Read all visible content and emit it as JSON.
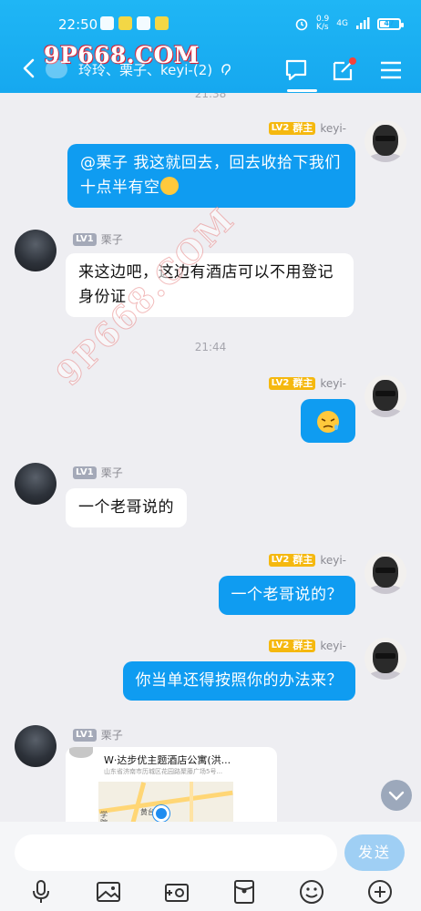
{
  "status_bar": {
    "time": "22:50",
    "network_speed": "0.9\nK/s",
    "network_type": "4G",
    "battery": "47",
    "battery_level": 0.47
  },
  "watermark": {
    "top": "9P668.COM",
    "diagonal": "9P668.COM"
  },
  "header": {
    "title": "玲玲、栗子、keyi-(2)",
    "icons": [
      "back-arrow-icon",
      "chat-bubble-icon",
      "edit-icon",
      "menu-icon"
    ],
    "accent_color": "#16a8ef",
    "notification_dot_color": "#f5433a"
  },
  "messages": [
    {
      "type": "time",
      "text": "21:38"
    },
    {
      "type": "msg",
      "side": "right",
      "sender": "keyi-",
      "level": "LV2",
      "role": "群主",
      "text": "@栗子  我这就回去，回去收拾下我们十点半有空"
    },
    {
      "type": "msg",
      "side": "left",
      "sender": "栗子",
      "level": "LV1",
      "text": "来这边吧，这边有酒店可以不用登记身份证"
    },
    {
      "type": "time",
      "text": "21:44"
    },
    {
      "type": "msg",
      "side": "right",
      "sender": "keyi-",
      "level": "LV2",
      "role": "群主",
      "text": "",
      "emoji": "tired-face-emoji"
    },
    {
      "type": "msg",
      "side": "left",
      "sender": "栗子",
      "level": "LV1",
      "text": "一个老哥说的"
    },
    {
      "type": "msg",
      "side": "right",
      "sender": "keyi-",
      "level": "LV2",
      "role": "群主",
      "text": "一个老哥说的？"
    },
    {
      "type": "msg",
      "side": "right",
      "sender": "keyi-",
      "level": "LV2",
      "role": "群主",
      "text": "你当单还得按照你的办法来？"
    },
    {
      "type": "location",
      "side": "left",
      "sender": "栗子",
      "level": "LV1",
      "title": "W·达步优主题酒店公寓(洪...",
      "address": "山东省济南市历城区花园路聚藤广场5号...",
      "map_labels": [
        "黄台南路",
        "学院"
      ]
    }
  ],
  "input": {
    "placeholder": "",
    "send_label": "发送"
  },
  "toolbar": [
    "microphone-icon",
    "image-icon",
    "camera-icon",
    "red-packet-icon",
    "emoji-icon",
    "plus-icon"
  ]
}
